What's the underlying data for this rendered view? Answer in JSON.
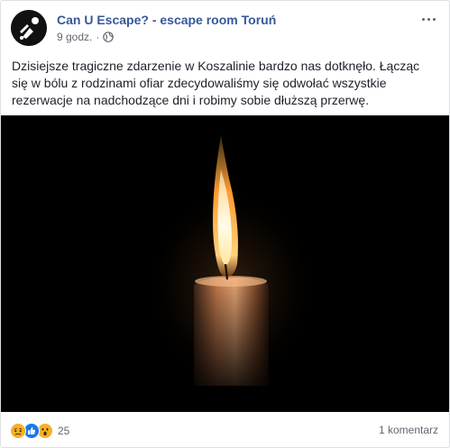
{
  "post": {
    "page_name": "Can U Escape? - escape room Toruń",
    "timestamp": "9 godz.",
    "separator": "·",
    "privacy_icon": "globe-icon",
    "avatar_icon": "can-u-escape-logo",
    "more_icon": "more-options-icon",
    "text": "Dzisiejsze tragiczne zdarzenie w Koszalinie bardzo nas dotknęło. Łącząc się w bólu z rodzinami ofiar zdecydowaliśmy się odwołać wszystkie rezerwacje na nadchodzące dni i robimy sobie dłuższą przerwę.",
    "image": "candle-photo"
  },
  "footer": {
    "reactions": [
      "sad-reaction-icon",
      "like-reaction-icon",
      "wow-reaction-icon"
    ],
    "reaction_count": "25",
    "comments": "1 komentarz"
  },
  "colors": {
    "link": "#365899",
    "secondary_text": "#616770",
    "like": "#1877f2",
    "reaction_yellow": "#f7b125"
  }
}
